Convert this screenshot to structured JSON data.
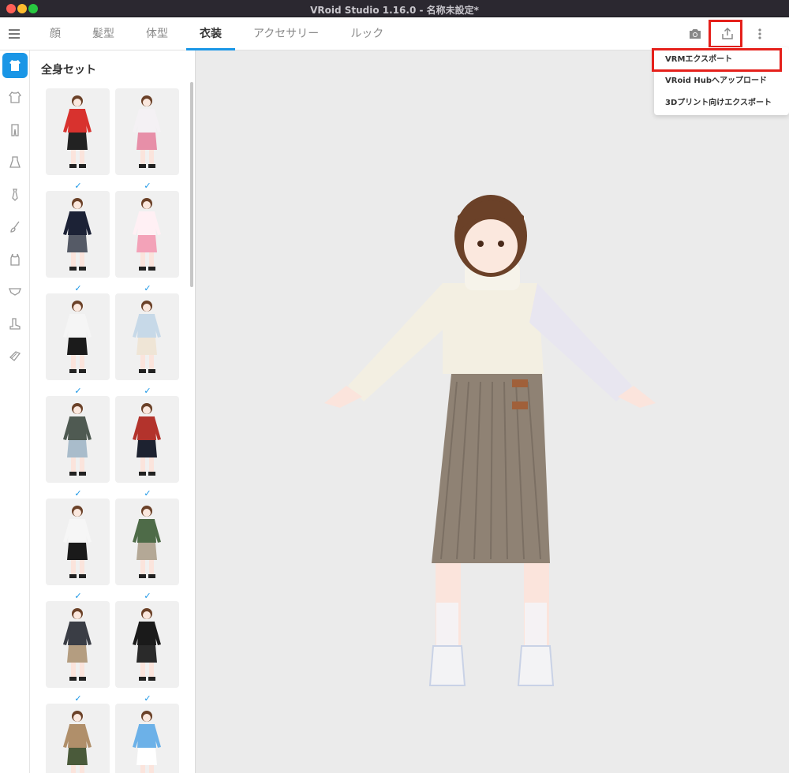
{
  "window": {
    "title": "VRoid Studio 1.16.0 - 名称未設定*"
  },
  "nav": {
    "tabs": [
      {
        "label": "顔",
        "active": false
      },
      {
        "label": "髪型",
        "active": false
      },
      {
        "label": "体型",
        "active": false
      },
      {
        "label": "衣装",
        "active": true
      },
      {
        "label": "アクセサリー",
        "active": false
      },
      {
        "label": "ルック",
        "active": false
      }
    ],
    "icons": [
      "menu-icon",
      "camera-icon",
      "export-icon",
      "more-vertical-icon"
    ]
  },
  "sidebar": {
    "categories": [
      "full-outfit",
      "top",
      "pants",
      "onepiece",
      "necktie",
      "brush",
      "tanktop",
      "underwear",
      "shoes",
      "accessory-tag"
    ],
    "active_category": "full-outfit"
  },
  "panel": {
    "title": "全身セット",
    "items": [
      {
        "name": "red-hoodie-outfit",
        "top": "#d8322e",
        "bottom": "#222222",
        "checked": false
      },
      {
        "name": "pink-skirt-outfit",
        "top": "#f4f1f4",
        "bottom": "#e78fa8",
        "checked": false
      },
      {
        "name": "navy-blazer-outfit",
        "top": "#1c2236",
        "bottom": "#555a66",
        "checked": true
      },
      {
        "name": "pink-maid-outfit",
        "top": "#fff0f4",
        "bottom": "#f3a2b8",
        "checked": true
      },
      {
        "name": "sailor-shorts-outfit",
        "top": "#f5f5f5",
        "bottom": "#1b1b1b",
        "checked": true
      },
      {
        "name": "denim-jacket-dress-outfit",
        "top": "#c7d9e8",
        "bottom": "#efe5d6",
        "checked": true
      },
      {
        "name": "floral-shirt-shorts-outfit",
        "top": "#4f5a52",
        "bottom": "#a9bccb",
        "checked": true
      },
      {
        "name": "red-floral-shirt-outfit",
        "top": "#b3332c",
        "bottom": "#1d2230",
        "checked": true
      },
      {
        "name": "white-top-leggings-outfit",
        "top": "#f6f6f6",
        "bottom": "#1a1a1a",
        "checked": true
      },
      {
        "name": "green-hoodie-skirt-outfit",
        "top": "#4e6b48",
        "bottom": "#b4a896",
        "checked": true
      },
      {
        "name": "gray-shirt-chinos-outfit",
        "top": "#3a3d45",
        "bottom": "#b49d80",
        "checked": true
      },
      {
        "name": "black-long-dress-outfit",
        "top": "#1a1a1a",
        "bottom": "#2a2a2a",
        "checked": true
      },
      {
        "name": "trench-coat-outfit",
        "top": "#b08f6a",
        "bottom": "#4a5a3a",
        "checked": true
      },
      {
        "name": "blue-maid-outfit",
        "top": "#6cb1e8",
        "bottom": "#ffffff",
        "checked": true
      }
    ]
  },
  "export_menu": {
    "items": [
      {
        "label": "VRMエクスポート",
        "highlighted": true
      },
      {
        "label": "VRoid Hubへアップロード",
        "highlighted": false
      },
      {
        "label": "3Dプリント向けエクスポート",
        "highlighted": false
      }
    ]
  },
  "colors": {
    "accent": "#1a96e6",
    "highlight": "#e5201b",
    "sweater": "#f3efe2",
    "skirt": "#8f8274",
    "hair": "#6b4128"
  }
}
